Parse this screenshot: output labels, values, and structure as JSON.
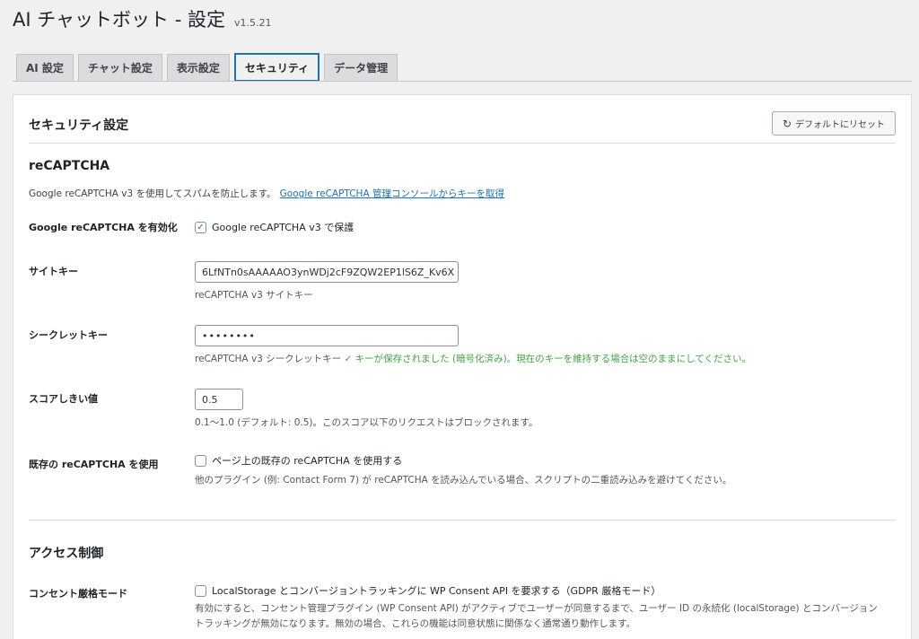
{
  "header": {
    "title": "AI チャットボット - 設定",
    "version": "v1.5.21"
  },
  "tabs": [
    {
      "label": "AI 設定"
    },
    {
      "label": "チャット設定"
    },
    {
      "label": "表示設定"
    },
    {
      "label": "セキュリティ"
    },
    {
      "label": "データ管理"
    }
  ],
  "panel": {
    "title": "セキュリティ設定",
    "reset_label": "デフォルトにリセット",
    "recaptcha": {
      "title": "reCAPTCHA",
      "description": "Google reCAPTCHA v3 を使用してスパムを防止します。",
      "console_link": "Google reCAPTCHA 管理コンソールからキーを取得",
      "enable_label": "Google reCAPTCHA を有効化",
      "enable_checkbox": "Google reCAPTCHA v3 で保護",
      "site_key_label": "サイトキー",
      "site_key_value": "6LfNTn0sAAAAAO3ynWDj2cF9ZQW2EP1lS6Z_Kv6X",
      "site_key_help": "reCAPTCHA v3 サイトキー",
      "secret_key_label": "シークレットキー",
      "secret_key_value": "••••••••",
      "secret_key_help": "reCAPTCHA v3 シークレットキー",
      "secret_key_saved": "✓ キーが保存されました (暗号化済み)。現在のキーを維持する場合は空のままにしてください。",
      "score_label": "スコアしきい値",
      "score_value": "0.5",
      "score_help": "0.1〜1.0 (デフォルト: 0.5)。このスコア以下のリクエストはブロックされます。",
      "existing_label": "既存の reCAPTCHA を使用",
      "existing_checkbox": "ページ上の既存の reCAPTCHA を使用する",
      "existing_help": "他のプラグイン (例: Contact Form 7) が reCAPTCHA を読み込んでいる場合、スクリプトの二重読み込みを避けてください。"
    },
    "access": {
      "title": "アクセス制御",
      "consent_label": "コンセント厳格モード",
      "consent_checkbox": "LocalStorage とコンバージョントラッキングに WP Consent API を要求する（GDPR 厳格モード）",
      "consent_help": "有効にすると、コンセント管理プラグイン (WP Consent API) がアクティブでユーザーが同意するまで、ユーザー ID の永続化 (localStorage) とコンバージョントラッキングが無効になります。無効の場合、これらの機能は同意状態に関係なく通常通り動作します。"
    }
  },
  "colors": {
    "accent": "#2271b1",
    "success": "#46a046"
  }
}
